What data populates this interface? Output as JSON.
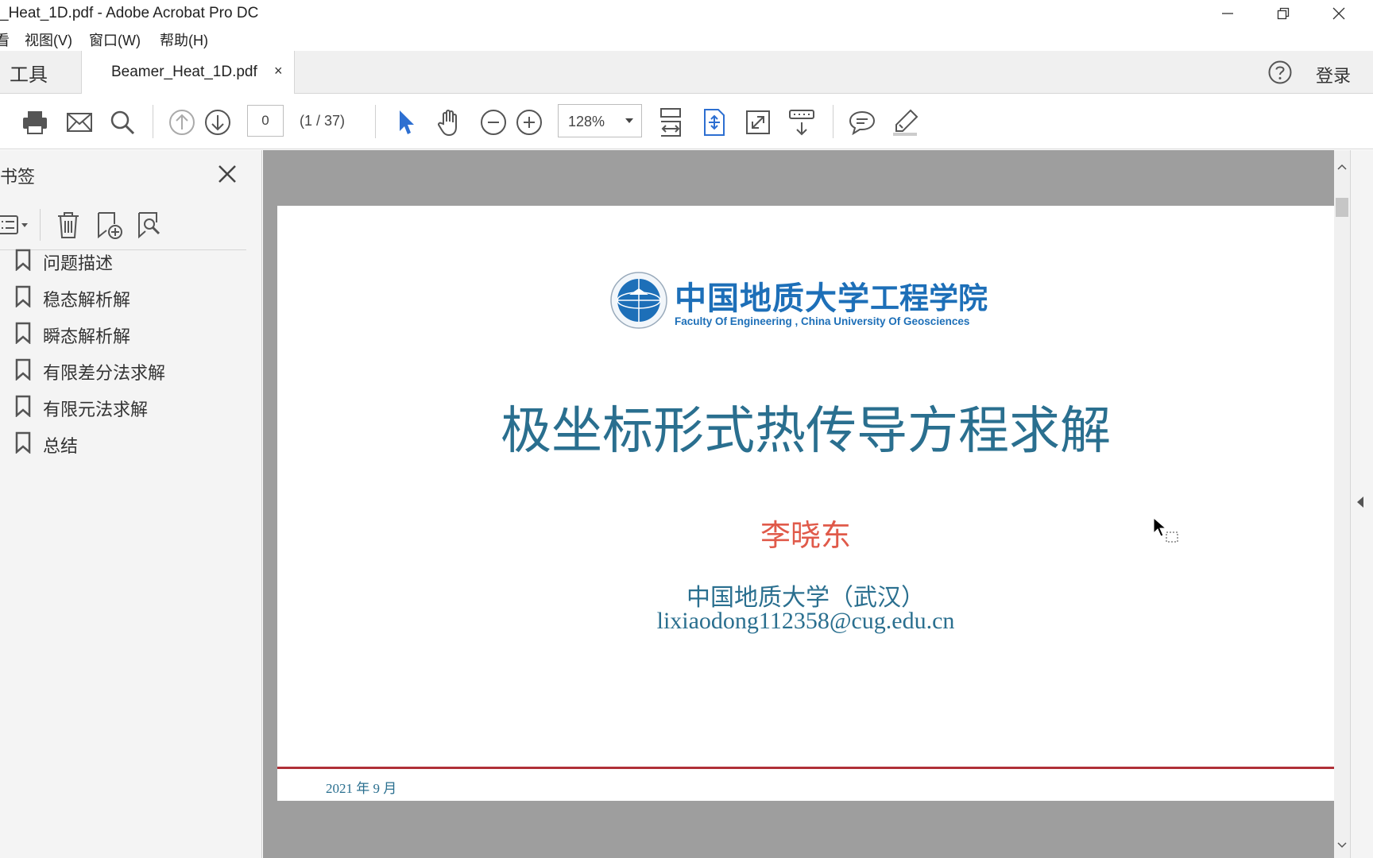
{
  "window": {
    "title": "_Heat_1D.pdf - Adobe Acrobat Pro DC"
  },
  "menu": {
    "items": [
      "看",
      "视图(V)",
      "窗口(W)",
      "帮助(H)"
    ]
  },
  "tabs": {
    "tools": "工具",
    "document": "Beamer_Heat_1D.pdf",
    "close": "×",
    "login": "登录"
  },
  "toolbar": {
    "page_input": "0",
    "page_count": "(1 / 37)",
    "zoom": "128%"
  },
  "sidebar": {
    "title": "书签",
    "bookmarks": [
      {
        "label": "问题描述"
      },
      {
        "label": "稳态解析解"
      },
      {
        "label": "瞬态解析解"
      },
      {
        "label": "有限差分法求解"
      },
      {
        "label": "有限元法求解"
      },
      {
        "label": "总结"
      }
    ]
  },
  "document": {
    "logo_zh": "中国地质大学",
    "logo_dept": "工程学院",
    "logo_en": "Faculty Of Engineering , China University Of Geosciences",
    "title": "极坐标形式热传导方程求解",
    "author": "李晓东",
    "affiliation": "中国地质大学（武汉）",
    "email": "lixiaodong112358@cug.edu.cn",
    "date": "2021 年 9 月"
  },
  "colors": {
    "accent_blue": "#1d6fb8",
    "title_teal": "#2a6f8f",
    "author_red": "#e05a4a",
    "rule_red": "#b03038"
  }
}
